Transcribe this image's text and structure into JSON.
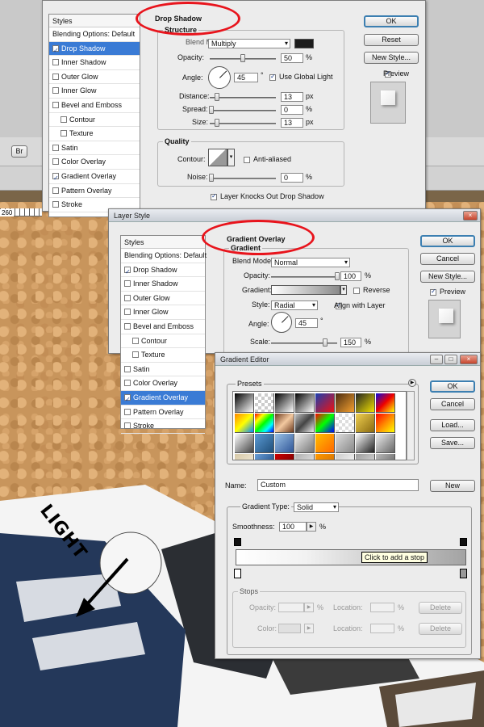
{
  "background": {
    "toolbar_button": "Br",
    "ruler_number": "260",
    "light_label": "LIGHT"
  },
  "drop_shadow_dialog": {
    "styles_header": "Styles",
    "styles_list": [
      {
        "label": "Blending Options: Default",
        "checkbox": false,
        "checked": false,
        "selected": false,
        "sub": false
      },
      {
        "label": "Drop Shadow",
        "checkbox": true,
        "checked": true,
        "selected": true,
        "sub": false
      },
      {
        "label": "Inner Shadow",
        "checkbox": true,
        "checked": false,
        "selected": false,
        "sub": false
      },
      {
        "label": "Outer Glow",
        "checkbox": true,
        "checked": false,
        "selected": false,
        "sub": false
      },
      {
        "label": "Inner Glow",
        "checkbox": true,
        "checked": false,
        "selected": false,
        "sub": false
      },
      {
        "label": "Bevel and Emboss",
        "checkbox": true,
        "checked": false,
        "selected": false,
        "sub": false
      },
      {
        "label": "Contour",
        "checkbox": true,
        "checked": false,
        "selected": false,
        "sub": true
      },
      {
        "label": "Texture",
        "checkbox": true,
        "checked": false,
        "selected": false,
        "sub": true
      },
      {
        "label": "Satin",
        "checkbox": true,
        "checked": false,
        "selected": false,
        "sub": false
      },
      {
        "label": "Color Overlay",
        "checkbox": true,
        "checked": false,
        "selected": false,
        "sub": false
      },
      {
        "label": "Gradient Overlay",
        "checkbox": true,
        "checked": true,
        "selected": false,
        "sub": false
      },
      {
        "label": "Pattern Overlay",
        "checkbox": true,
        "checked": false,
        "selected": false,
        "sub": false
      },
      {
        "label": "Stroke",
        "checkbox": true,
        "checked": false,
        "selected": false,
        "sub": false
      }
    ],
    "section_title": "Drop Shadow",
    "structure": {
      "title": "Structure",
      "blend_mode_label": "Blend Mode:",
      "blend_mode_value": "Multiply",
      "shadow_color": "#1c1c1c",
      "opacity_label": "Opacity:",
      "opacity_value": "50",
      "opacity_unit": "%",
      "opacity_level": 0.5,
      "angle_label": "Angle:",
      "angle_value": "45",
      "angle_unit": "°",
      "global_light_label": "Use Global Light",
      "distance_label": "Distance:",
      "distance_value": "13",
      "distance_unit": "px",
      "spread_label": "Spread:",
      "spread_value": "0",
      "spread_unit": "%",
      "size_label": "Size:",
      "size_value": "13",
      "size_unit": "px"
    },
    "quality": {
      "title": "Quality",
      "contour_label": "Contour:",
      "anti_aliased_label": "Anti-aliased",
      "noise_label": "Noise:",
      "noise_value": "0",
      "noise_unit": "%",
      "knockout_label": "Layer Knocks Out Drop Shadow"
    },
    "buttons": {
      "ok": "OK",
      "reset": "Reset",
      "new_style": "New Style...",
      "preview": "Preview"
    }
  },
  "gradient_overlay_dialog": {
    "title": "Layer Style",
    "styles_header": "Styles",
    "styles_list": [
      {
        "label": "Blending Options: Default",
        "checkbox": false,
        "checked": false,
        "selected": false,
        "sub": false
      },
      {
        "label": "Drop Shadow",
        "checkbox": true,
        "checked": true,
        "selected": false,
        "sub": false
      },
      {
        "label": "Inner Shadow",
        "checkbox": true,
        "checked": false,
        "selected": false,
        "sub": false
      },
      {
        "label": "Outer Glow",
        "checkbox": true,
        "checked": false,
        "selected": false,
        "sub": false
      },
      {
        "label": "Inner Glow",
        "checkbox": true,
        "checked": false,
        "selected": false,
        "sub": false
      },
      {
        "label": "Bevel and Emboss",
        "checkbox": true,
        "checked": false,
        "selected": false,
        "sub": false
      },
      {
        "label": "Contour",
        "checkbox": true,
        "checked": false,
        "selected": false,
        "sub": true
      },
      {
        "label": "Texture",
        "checkbox": true,
        "checked": false,
        "selected": false,
        "sub": true
      },
      {
        "label": "Satin",
        "checkbox": true,
        "checked": false,
        "selected": false,
        "sub": false
      },
      {
        "label": "Color Overlay",
        "checkbox": true,
        "checked": false,
        "selected": false,
        "sub": false
      },
      {
        "label": "Gradient Overlay",
        "checkbox": true,
        "checked": true,
        "selected": true,
        "sub": false
      },
      {
        "label": "Pattern Overlay",
        "checkbox": true,
        "checked": false,
        "selected": false,
        "sub": false
      },
      {
        "label": "Stroke",
        "checkbox": true,
        "checked": false,
        "selected": false,
        "sub": false
      }
    ],
    "section_title": "Gradient Overlay",
    "gradient_group_title": "Gradient",
    "blend_mode_label": "Blend Mode:",
    "blend_mode_value": "Normal",
    "opacity_label": "Opacity:",
    "opacity_value": "100",
    "opacity_unit": "%",
    "gradient_label": "Gradient:",
    "reverse_label": "Reverse",
    "style_label": "Style:",
    "style_value": "Radial",
    "align_label": "Align with Layer",
    "angle_label": "Angle:",
    "angle_value": "45",
    "angle_unit": "°",
    "scale_label": "Scale:",
    "scale_value": "150",
    "scale_unit": "%",
    "buttons": {
      "ok": "OK",
      "cancel": "Cancel",
      "new_style": "New Style...",
      "preview": "Preview"
    }
  },
  "gradient_editor": {
    "title": "Gradient Editor",
    "presets_label": "Presets",
    "buttons": {
      "ok": "OK",
      "cancel": "Cancel",
      "load": "Load...",
      "save": "Save..."
    },
    "name_label": "Name:",
    "name_value": "Custom",
    "new_button": "New",
    "gradient_type_label": "Gradient Type:",
    "gradient_type_value": "Solid",
    "smoothness_label": "Smoothness:",
    "smoothness_value": "100",
    "smoothness_unit": "%",
    "tooltip": "Click to add a stop",
    "stops_title": "Stops",
    "stop_opacity_label": "Opacity:",
    "stop_opacity_unit": "%",
    "location_label": "Location:",
    "location_unit": "%",
    "delete_label": "Delete",
    "color_label": "Color:"
  }
}
